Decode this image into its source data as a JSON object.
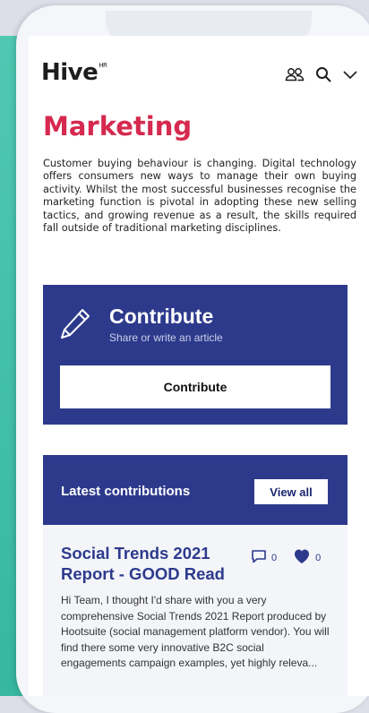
{
  "app": {
    "logo_text": "Hive",
    "logo_sup": "HR"
  },
  "header": {
    "icons": [
      "users-icon",
      "search-icon",
      "chevron-down-icon"
    ]
  },
  "page": {
    "title": "Marketing",
    "intro": "Customer buying behaviour is changing. Digital technology offers consumers new ways to manage their own buying activity. Whilst the most successful businesses recognise the marketing function is pivotal in adopting these new selling tactics, and growing revenue as a result, the skills required fall outside of traditional marketing disciplines."
  },
  "contribute": {
    "icon": "pencil-icon",
    "title": "Contribute",
    "subtitle": "Share or write an article",
    "button_label": "Contribute"
  },
  "latest": {
    "title": "Latest contributions",
    "view_all_label": "View all"
  },
  "article": {
    "title": "Social Trends 2021 Report - GOOD Read",
    "comments_count": "0",
    "likes_count": "0",
    "excerpt": "Hi Team, I thought I'd share with you a very comprehensive Social Trends 2021 Report produced by Hootsuite (social management platform vendor). You will find there some very innovative B2C social engagements campaign examples, yet highly releva..."
  },
  "colors": {
    "accent_red": "#d6294f",
    "brand_navy": "#2d3a8c",
    "teal": "#3fbfa7"
  }
}
